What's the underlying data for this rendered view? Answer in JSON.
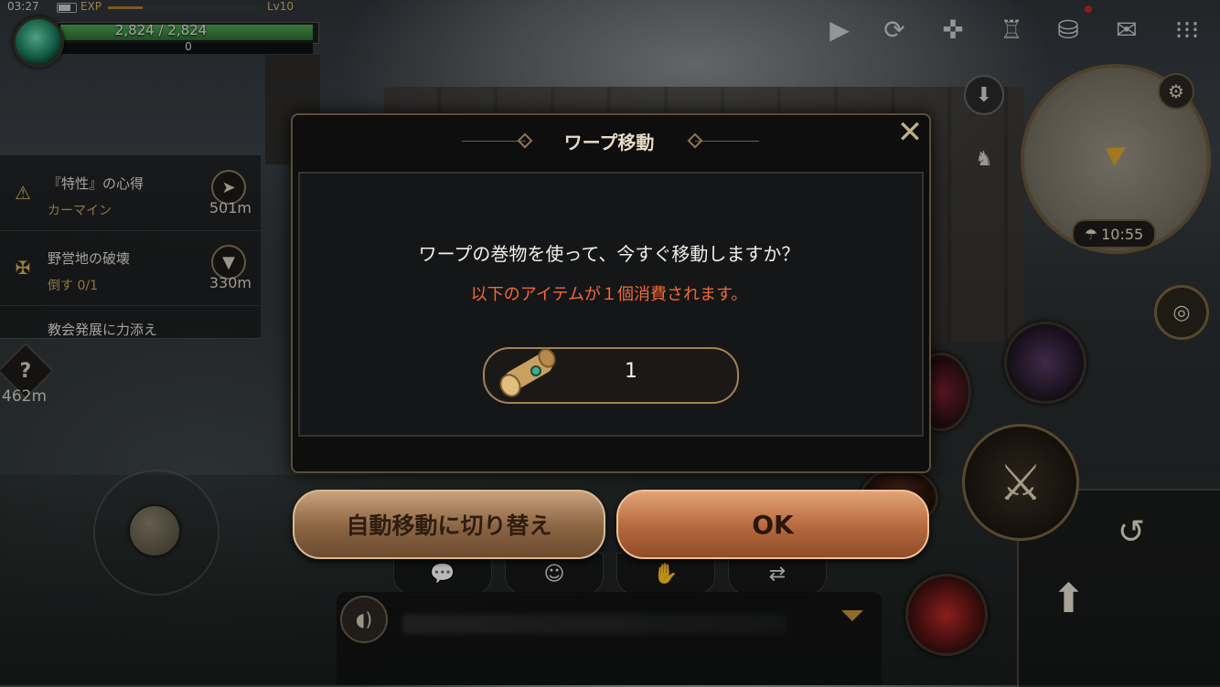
{
  "status": {
    "time": "03:27",
    "exp_label": "EXP",
    "level": "Lv10"
  },
  "player": {
    "hp_text": "2,824 / 2,824",
    "mp_text": "0"
  },
  "quests": [
    {
      "title": "『特性』の心得",
      "sub": "カーマイン",
      "distance": "501m"
    },
    {
      "title": "野営地の破壊",
      "sub": "倒す 0/1",
      "distance": "330m"
    },
    {
      "title": "教会発展に力添え",
      "sub": "",
      "distance": ""
    }
  ],
  "help": {
    "distance": "462m"
  },
  "minimap": {
    "clock": "10:55"
  },
  "dialog": {
    "title": "ワープ移動",
    "message": "ワープの巻物を使って、今すぐ移動しますか？",
    "warning": "以下のアイテムが１個消費されます。",
    "item_count": "1",
    "auto_button": "自動移動に切り替え",
    "ok_button": "OK"
  },
  "colors": {
    "accent": "#b4683d",
    "warning": "#f06a3a",
    "hp": "#4fa655"
  }
}
